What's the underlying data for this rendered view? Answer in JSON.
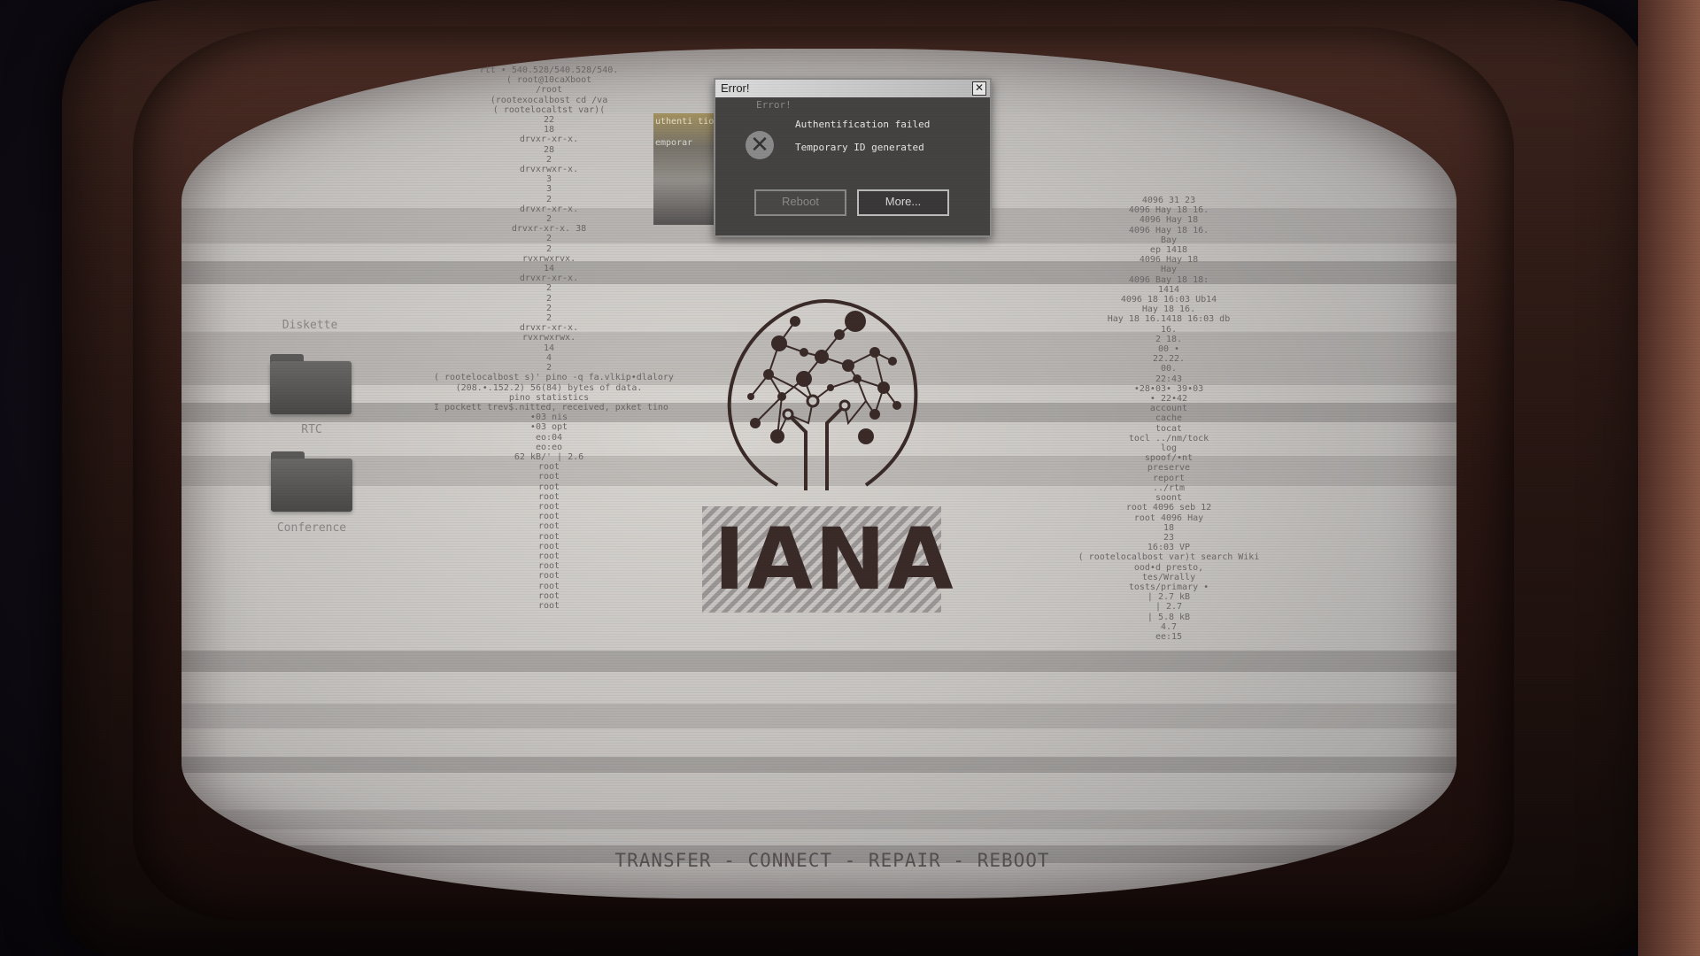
{
  "desktop": {
    "icons": [
      {
        "label": "Diskette"
      },
      {
        "label": "RTC"
      },
      {
        "label": "Conference"
      }
    ]
  },
  "error_dialog": {
    "title": "Error!",
    "close_symbol": "✕",
    "message_line1": "Authentification failed",
    "message_line2": "Temporary ID generated",
    "icon": "error-x-icon",
    "reboot_label": "Reboot",
    "more_label": "More..."
  },
  "terminal_left": [
    "rtt • 540.528/540.528/540.",
    "( root@10caXboot",
    "/root",
    "(rootexocalbost cd /va",
    "( rootelocaltst var)(",
    "22",
    "18",
    "drvxr-xr-x.",
    "28",
    "2",
    "drvxrwxr-x.",
    "3",
    "3",
    "2",
    "drvxr-xr-x.",
    "2",
    "drvxr-xr-x. 38",
    "2",
    "2",
    "rvxrwxrvx.",
    "14",
    "drvxr-xr-x.",
    "2",
    "2",
    "2",
    "2",
    "drvxr-xr-x.",
    "rvxrwxrwx.",
    "14",
    "4",
    "2",
    "( rootelocalbost s)' pino -q fa.vlkip•dlalory",
    "(208.•.152.2) 56(84) bytes of data.",
    "pino statistics",
    "I pockett trev$.nitted, received, pxket tino",
    "•03 nis",
    "•03 opt",
    "eo:04",
    "eo:eo",
    "62 kB/' | 2.6",
    "root",
    "root",
    "root",
    "root",
    "root",
    "root",
    "root",
    "root",
    "root",
    "root",
    "root",
    "root",
    "root",
    "root",
    "root"
  ],
  "terminal_right": [
    "4096 31 23",
    "4096 Hay 18 16.",
    "4096 Hay 18",
    "4096 Hay 18 16.",
    "Bay",
    "ep 1418",
    "4096 Hay 18",
    "Hay",
    "4096 Bay 18 18:",
    "1414",
    "4096 18 16:03 Ub14",
    "Hay 18 16.",
    "Hay 18 16.1418 16:03 db",
    "16.",
    "2 18.",
    "00 •",
    "22.22.",
    "00.",
    "22:43",
    "•28•03• 39•03",
    "• 22•42",
    "account",
    "cache",
    "tocat",
    "tocl ../nm/tock",
    "log",
    "spoof/•nt",
    "preserve",
    "report",
    "../rtm",
    "soont",
    "root 4096 seb 12",
    "root 4096 Hay",
    "18",
    "23",
    "16:03 VP",
    "( rootelocalbost var)t search Wiki",
    "ood•d presto,",
    "tes/Wrally",
    "tosts/primary •",
    "| 2.7 kB",
    "| 2.7",
    "| 5.8 kB",
    "4.7",
    "ee:15"
  ],
  "ghost_text": {
    "line1": "Error!",
    "line2": "uthenti  tion failed",
    "line3": "emporar"
  },
  "logo": {
    "icon": "brain-circuit-icon",
    "brand": "IANA"
  },
  "menu": {
    "text": "TRANSFER - CONNECT - REPAIR - REBOOT"
  }
}
